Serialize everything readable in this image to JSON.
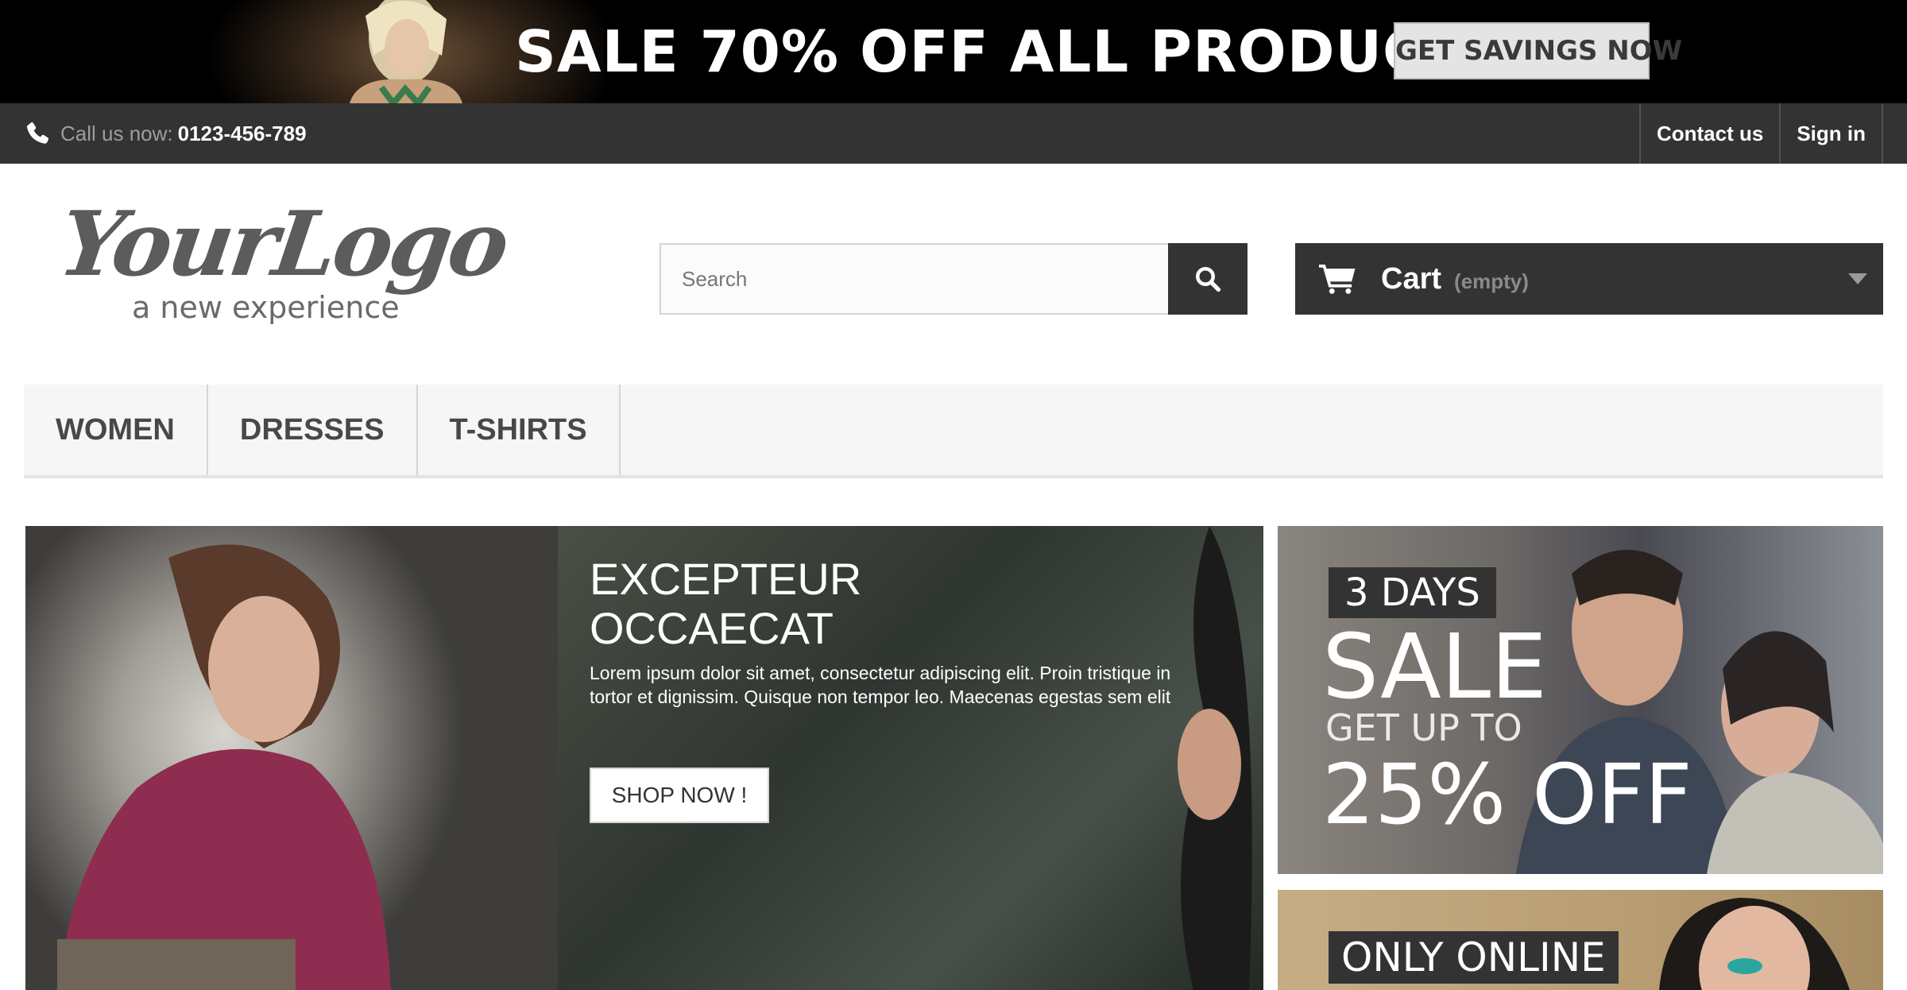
{
  "promo": {
    "headline": "SALE 70% OFF ALL PRODUCTS",
    "button": "GET SAVINGS NOW"
  },
  "topnav": {
    "call_label": "Call us now:",
    "phone": "0123-456-789",
    "icon": "phone-icon",
    "links": [
      "Contact us",
      "Sign in"
    ]
  },
  "header": {
    "logo_title": "YourLogo",
    "logo_tagline": "a new experience",
    "search_placeholder": "Search",
    "cart_label": "Cart",
    "cart_status": "(empty)"
  },
  "menu": {
    "items": [
      "WOMEN",
      "DRESSES",
      "T-SHIRTS"
    ]
  },
  "slider": {
    "title": "EXCEPTEUR\nOCCAECAT",
    "description": "Lorem ipsum dolor sit amet, consectetur adipiscing elit. Proin tristique in tortor et dignissim. Quisque non tempor leo. Maecenas egestas sem elit",
    "button": "SHOP NOW !"
  },
  "banners": {
    "sale": {
      "tag": "3 DAYS",
      "headline": "SALE",
      "subline": "GET UP TO",
      "offer": "25% OFF"
    },
    "online": {
      "tag": "ONLY ONLINE"
    }
  },
  "colors": {
    "dark": "#333333",
    "menu_bg": "#f6f6f6",
    "border": "#d6d4d4"
  }
}
